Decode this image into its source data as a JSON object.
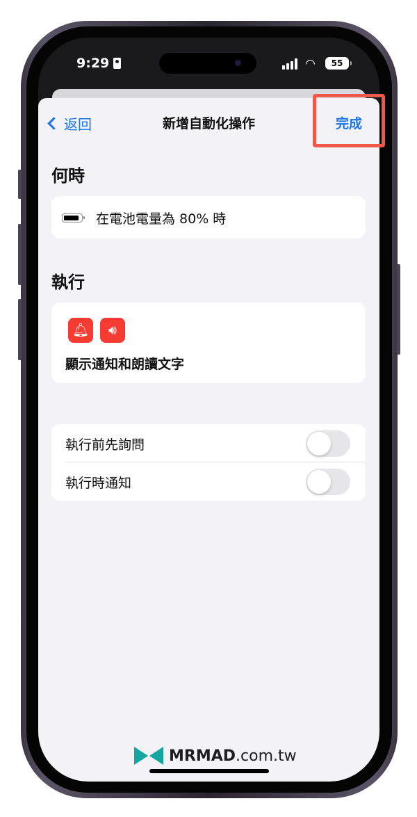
{
  "status_bar": {
    "time": "9:29",
    "battery": "55"
  },
  "nav": {
    "back_label": "返回",
    "title": "新增自動化操作",
    "done_label": "完成"
  },
  "when": {
    "title": "何時",
    "condition": "在電池電量為 80% 時"
  },
  "run": {
    "title": "執行",
    "action_label": "顯示通知和朗讀文字"
  },
  "options": [
    {
      "label": "執行前先詢問",
      "enabled": false
    },
    {
      "label": "執行時通知",
      "enabled": false
    }
  ],
  "watermark": {
    "brand": "MRMAD",
    "suffix": ".com.tw"
  },
  "colors": {
    "accent": "#1a73e8",
    "highlight": "#f0584a",
    "action_icon": "#f53b32",
    "brand": "#13a6a0"
  }
}
